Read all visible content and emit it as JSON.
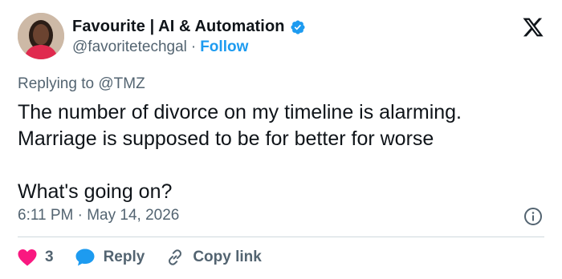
{
  "author": {
    "display_name": "Favourite | AI & Automation",
    "handle": "@favoritetechgal",
    "separator": "·",
    "follow_label": "Follow",
    "avatar_icon": "user-avatar",
    "verified_icon": "verified-badge-icon",
    "verified_color": "#1d9bf0"
  },
  "platform_icon": "x-logo-icon",
  "replying": {
    "prefix": "Replying to",
    "mention": "@TMZ"
  },
  "tweet": {
    "text": "The number of divorce on my timeline is alarming.\nMarriage is supposed to be for better for worse\n\nWhat's going on?",
    "timestamp": "6:11 PM · May 14, 2026"
  },
  "actions": {
    "like_count": "3",
    "reply_label": "Reply",
    "copy_link_label": "Copy link",
    "like_color": "#f91880",
    "reply_color": "#1d9bf0"
  },
  "info_icon": "info-icon"
}
